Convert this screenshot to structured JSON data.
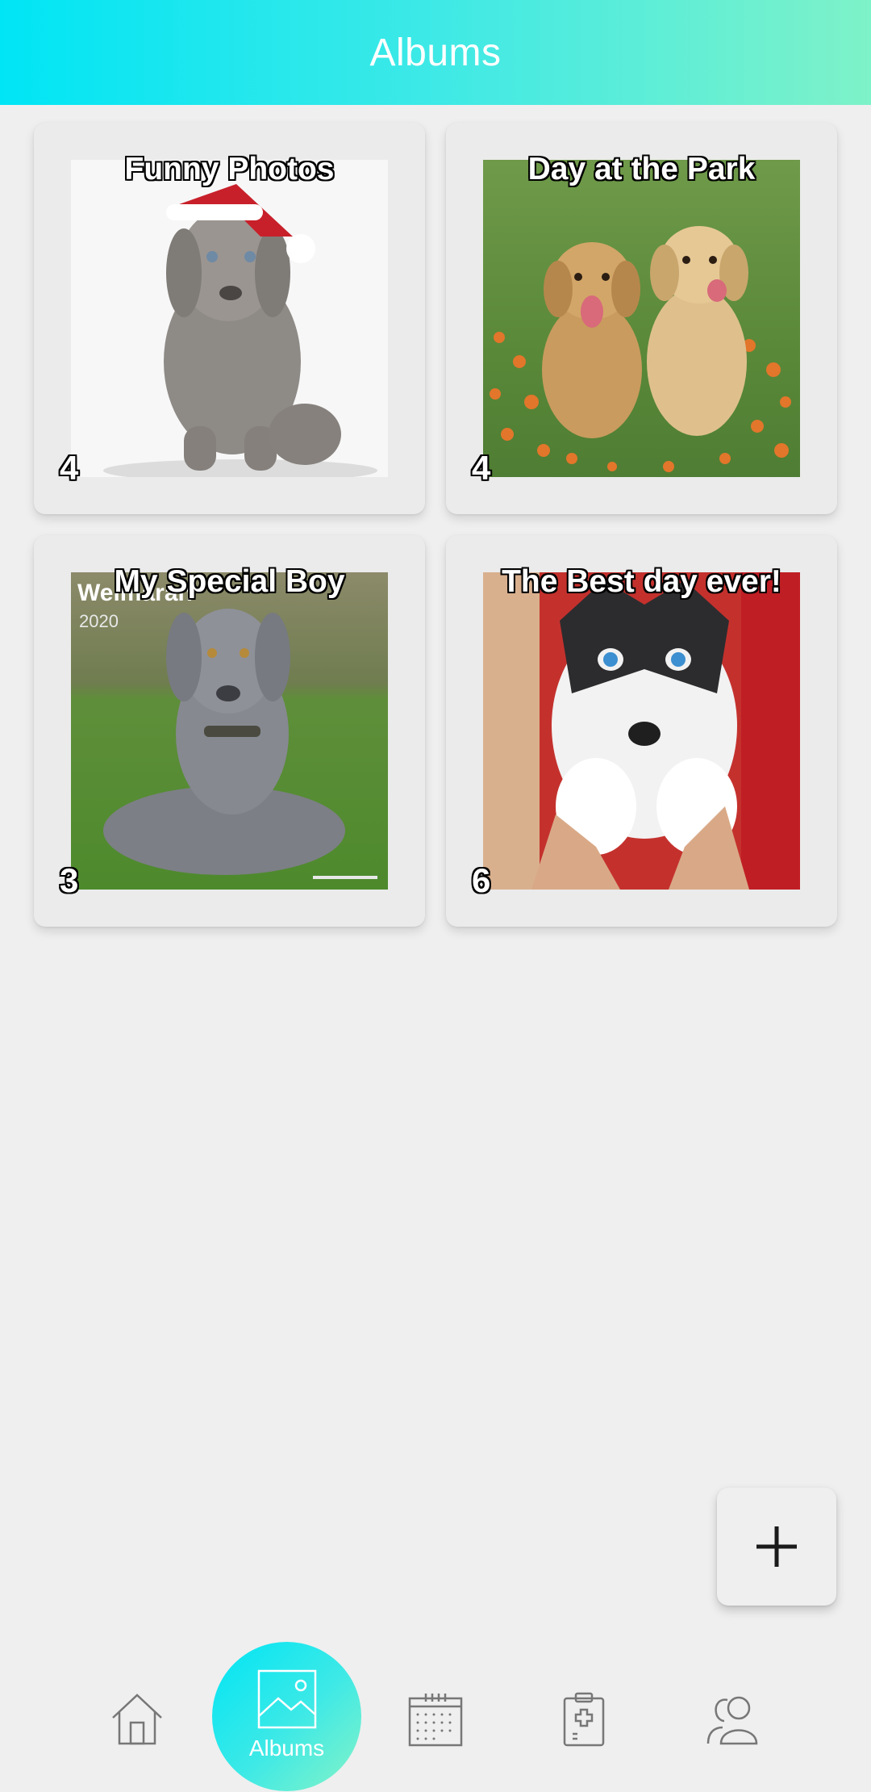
{
  "header": {
    "title": "Albums"
  },
  "albums": [
    {
      "title": "Funny Photos",
      "count": "4"
    },
    {
      "title": "Day at the Park",
      "count": "4"
    },
    {
      "title": "My Special Boy",
      "count": "3"
    },
    {
      "title": "The Best day ever!",
      "count": "6"
    }
  ],
  "fab": {
    "icon": "plus-icon"
  },
  "nav": {
    "home_icon": "home-icon",
    "albums_label": "Albums",
    "calendar_icon": "calendar-icon",
    "medical_icon": "medical-clipboard-icon",
    "contacts_icon": "people-icon"
  },
  "colors": {
    "accent_start": "#00e5f5",
    "accent_end": "#7ef2c8",
    "background": "#efefef",
    "card": "#ebebeb"
  }
}
